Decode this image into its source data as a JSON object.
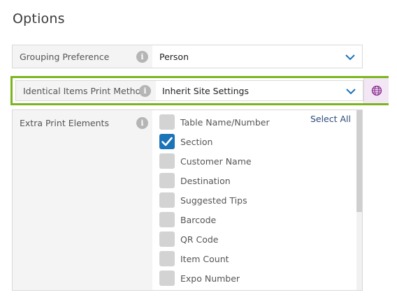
{
  "section_title": "Options",
  "grouping": {
    "label": "Grouping Preference",
    "value": "Person"
  },
  "identical": {
    "label": "Identical Items Print Method",
    "value": "Inherit Site Settings"
  },
  "extras": {
    "label": "Extra Print Elements",
    "select_all": "Select All",
    "items": [
      {
        "label": "Table Name/Number",
        "checked": false
      },
      {
        "label": "Section",
        "checked": true
      },
      {
        "label": "Customer Name",
        "checked": false
      },
      {
        "label": "Destination",
        "checked": false
      },
      {
        "label": "Suggested Tips",
        "checked": false
      },
      {
        "label": "Barcode",
        "checked": false
      },
      {
        "label": "QR Code",
        "checked": false
      },
      {
        "label": "Item Count",
        "checked": false
      },
      {
        "label": "Expo Number",
        "checked": false
      }
    ]
  },
  "info_glyph": "i",
  "icons": [
    "info-icon",
    "chevron-down-icon",
    "globe-icon",
    "checkmark-icon"
  ],
  "colors": {
    "accent_green": "#7ab51d",
    "checkbox_blue": "#1b73b8",
    "chevron_blue": "#1b73b8",
    "globe_purple": "#8a2e91"
  }
}
